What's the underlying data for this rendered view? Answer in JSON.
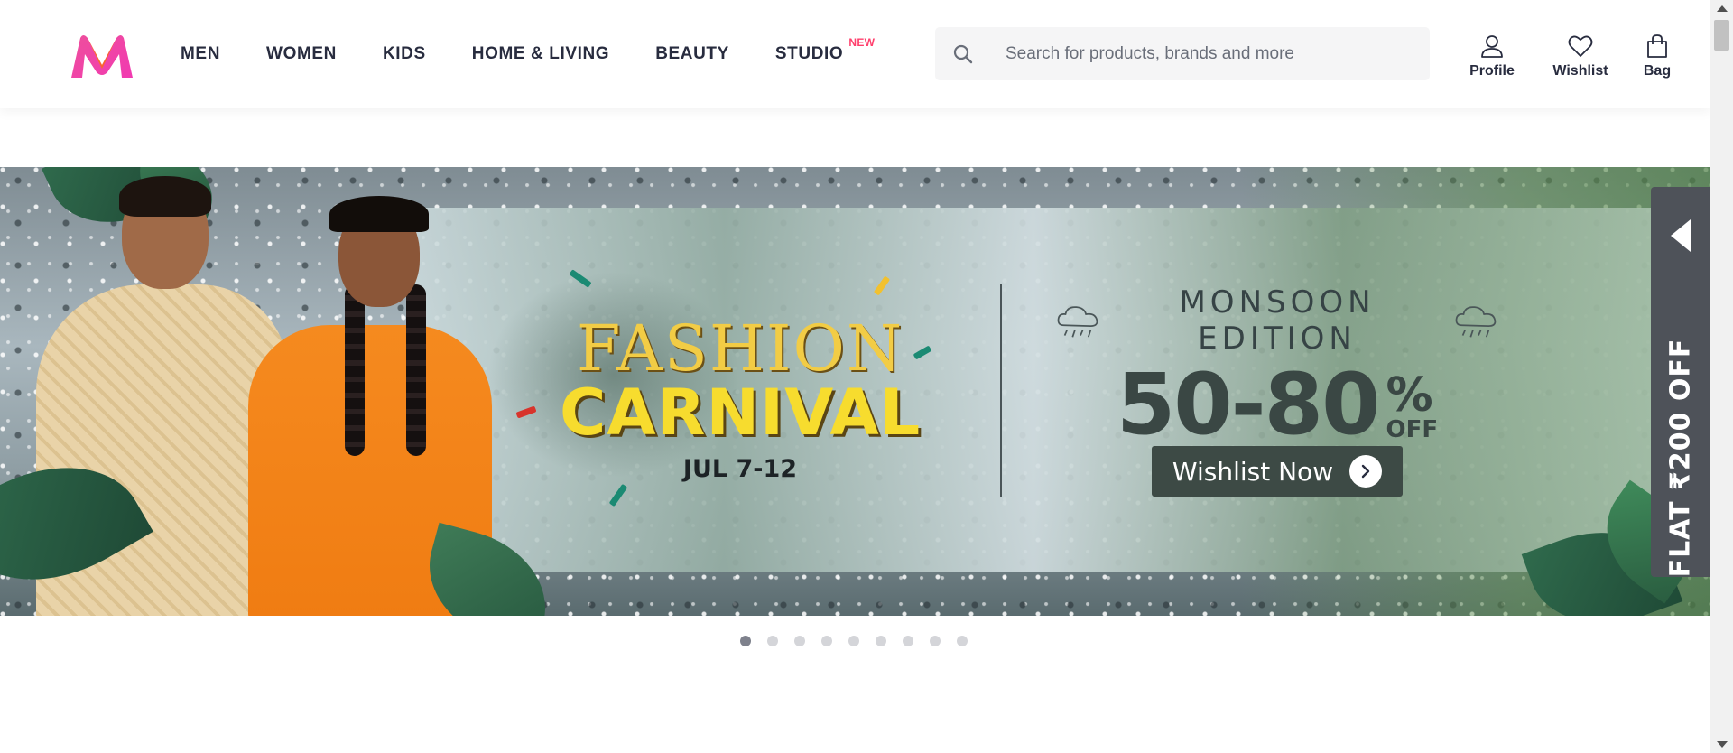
{
  "header": {
    "logo": "myntra-logo",
    "nav": [
      {
        "label": "MEN"
      },
      {
        "label": "WOMEN"
      },
      {
        "label": "KIDS"
      },
      {
        "label": "HOME & LIVING"
      },
      {
        "label": "BEAUTY"
      },
      {
        "label": "STUDIO",
        "tag": "NEW"
      }
    ],
    "search": {
      "placeholder": "Search for products, brands and more",
      "value": "",
      "icon": "search-icon"
    },
    "actions": [
      {
        "label": "Profile",
        "icon": "user-icon"
      },
      {
        "label": "Wishlist",
        "icon": "heart-icon"
      },
      {
        "label": "Bag",
        "icon": "bag-icon"
      }
    ]
  },
  "banner": {
    "title_line1": "FASHION",
    "title_line2": "CARNIVAL",
    "dates": "JUL 7-12",
    "edition": "MONSOON EDITION",
    "discount": "50-80",
    "percent_sign": "%",
    "off": "OFF",
    "cta": "Wishlist Now",
    "side_tab": "FLAT ₹200 OFF"
  },
  "carousel": {
    "total_slides": 9,
    "active_index": 0
  },
  "colors": {
    "brand_pink": "#ff3f6c",
    "nav_text": "#282c3f",
    "headline_gold": "#f2cc45",
    "offer_dark": "#3a4744"
  }
}
